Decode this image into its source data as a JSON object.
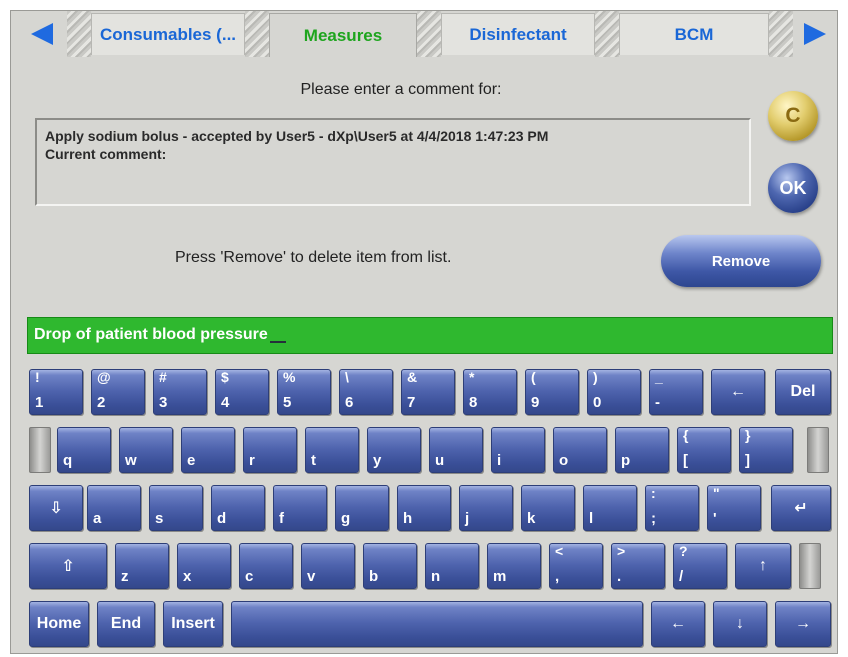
{
  "tabs": {
    "items": [
      {
        "label": "Consumables (..."
      },
      {
        "label": "Measures"
      },
      {
        "label": "Disinfectant"
      },
      {
        "label": "BCM"
      }
    ]
  },
  "dialog": {
    "prompt": "Please enter a comment for:",
    "comment_line1": "Apply sodium bolus - accepted by User5 - dXp\\User5 at 4/4/2018 1:47:23 PM",
    "comment_line2": "Current comment:",
    "remove_hint": "Press 'Remove' to delete item from list.",
    "c_label": "C",
    "ok_label": "OK",
    "remove_label": "Remove"
  },
  "input": {
    "value": "Drop of patient blood pressure"
  },
  "keyboard": {
    "row1": [
      {
        "hi": "!",
        "lo": "1"
      },
      {
        "hi": "@",
        "lo": "2"
      },
      {
        "hi": "#",
        "lo": "3"
      },
      {
        "hi": "$",
        "lo": "4"
      },
      {
        "hi": "%",
        "lo": "5"
      },
      {
        "hi": "\\",
        "lo": "6"
      },
      {
        "hi": "&",
        "lo": "7"
      },
      {
        "hi": "*",
        "lo": "8"
      },
      {
        "hi": "(",
        "lo": "9"
      },
      {
        "hi": ")",
        "lo": "0"
      },
      {
        "hi": "_",
        "lo": "-"
      }
    ],
    "backspace": "←",
    "del": "Del",
    "row2": [
      {
        "hi": "",
        "lo": "q"
      },
      {
        "hi": "",
        "lo": "w"
      },
      {
        "hi": "",
        "lo": "e"
      },
      {
        "hi": "",
        "lo": "r"
      },
      {
        "hi": "",
        "lo": "t"
      },
      {
        "hi": "",
        "lo": "y"
      },
      {
        "hi": "",
        "lo": "u"
      },
      {
        "hi": "",
        "lo": "i"
      },
      {
        "hi": "",
        "lo": "o"
      },
      {
        "hi": "",
        "lo": "p"
      },
      {
        "hi": "{",
        "lo": "["
      },
      {
        "hi": "}",
        "lo": "]"
      }
    ],
    "caps": "⇩",
    "row3": [
      {
        "hi": "",
        "lo": "a"
      },
      {
        "hi": "",
        "lo": "s"
      },
      {
        "hi": "",
        "lo": "d"
      },
      {
        "hi": "",
        "lo": "f"
      },
      {
        "hi": "",
        "lo": "g"
      },
      {
        "hi": "",
        "lo": "h"
      },
      {
        "hi": "",
        "lo": "j"
      },
      {
        "hi": "",
        "lo": "k"
      },
      {
        "hi": "",
        "lo": "l"
      },
      {
        "hi": ":",
        "lo": ";"
      },
      {
        "hi": "\"",
        "lo": "'"
      }
    ],
    "enter": "↵",
    "shift": "⇧",
    "row4": [
      {
        "hi": "",
        "lo": "z"
      },
      {
        "hi": "",
        "lo": "x"
      },
      {
        "hi": "",
        "lo": "c"
      },
      {
        "hi": "",
        "lo": "v"
      },
      {
        "hi": "",
        "lo": "b"
      },
      {
        "hi": "",
        "lo": "n"
      },
      {
        "hi": "",
        "lo": "m"
      },
      {
        "hi": "<",
        "lo": ","
      },
      {
        "hi": ">",
        "lo": "."
      },
      {
        "hi": "?",
        "lo": "/"
      }
    ],
    "up": "↑",
    "home": "Home",
    "end": "End",
    "insert": "Insert",
    "left": "←",
    "down": "↓",
    "right": "→"
  },
  "colors": {
    "tab_text": "#1a67d6",
    "tab_active_text": "#1ea51e",
    "input_background": "#2fb82f",
    "key_blue": "#4e63ad"
  }
}
